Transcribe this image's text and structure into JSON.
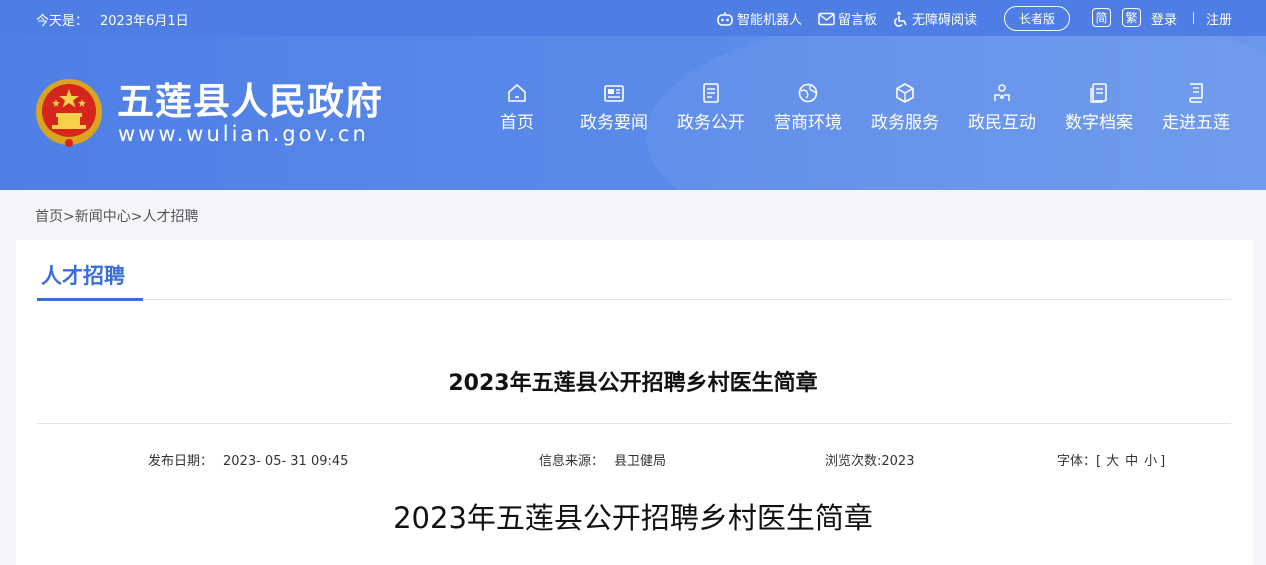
{
  "topbar": {
    "date_label": "今天是：",
    "date_value": "2023年6月1日",
    "robot": "智能机器人",
    "message_board": "留言板",
    "accessible": "无障碍阅读",
    "elder_version": "长者版",
    "simplified": "简",
    "traditional": "繁",
    "login": "登录",
    "register": "注册"
  },
  "header": {
    "site_name": "五莲县人民政府",
    "site_url": "www.wulian.gov.cn"
  },
  "nav": {
    "items": [
      {
        "label": "首页",
        "icon": "home-icon"
      },
      {
        "label": "政务要闻",
        "icon": "news-icon"
      },
      {
        "label": "政务公开",
        "icon": "document-icon"
      },
      {
        "label": "营商环境",
        "icon": "globe-icon"
      },
      {
        "label": "政务服务",
        "icon": "cube-icon"
      },
      {
        "label": "政民互动",
        "icon": "interaction-icon"
      },
      {
        "label": "数字档案",
        "icon": "archive-icon"
      },
      {
        "label": "走进五莲",
        "icon": "book-icon"
      }
    ]
  },
  "breadcrumb": {
    "home": "首页",
    "sep1": ">",
    "news": "新闻中心",
    "sep2": ">",
    "current": "人才招聘"
  },
  "category": {
    "title": "人才招聘"
  },
  "article": {
    "title": "2023年五莲县公开招聘乡村医生简章",
    "publish_label": "发布日期：",
    "publish_value": "2023- 05- 31 09:45",
    "source_label": "信息来源：",
    "source_value": "县卫健局",
    "views_label": "浏览次数:",
    "views_value": "2023",
    "font_label": "字体：",
    "font_open": "[",
    "font_large": "大",
    "font_medium": "中",
    "font_small": "小",
    "font_close": "]",
    "body_title": "2023年五莲县公开招聘乡村医生简章"
  },
  "colors": {
    "brand_blue": "#4e7ee4",
    "accent_blue": "#3a6fd8"
  }
}
